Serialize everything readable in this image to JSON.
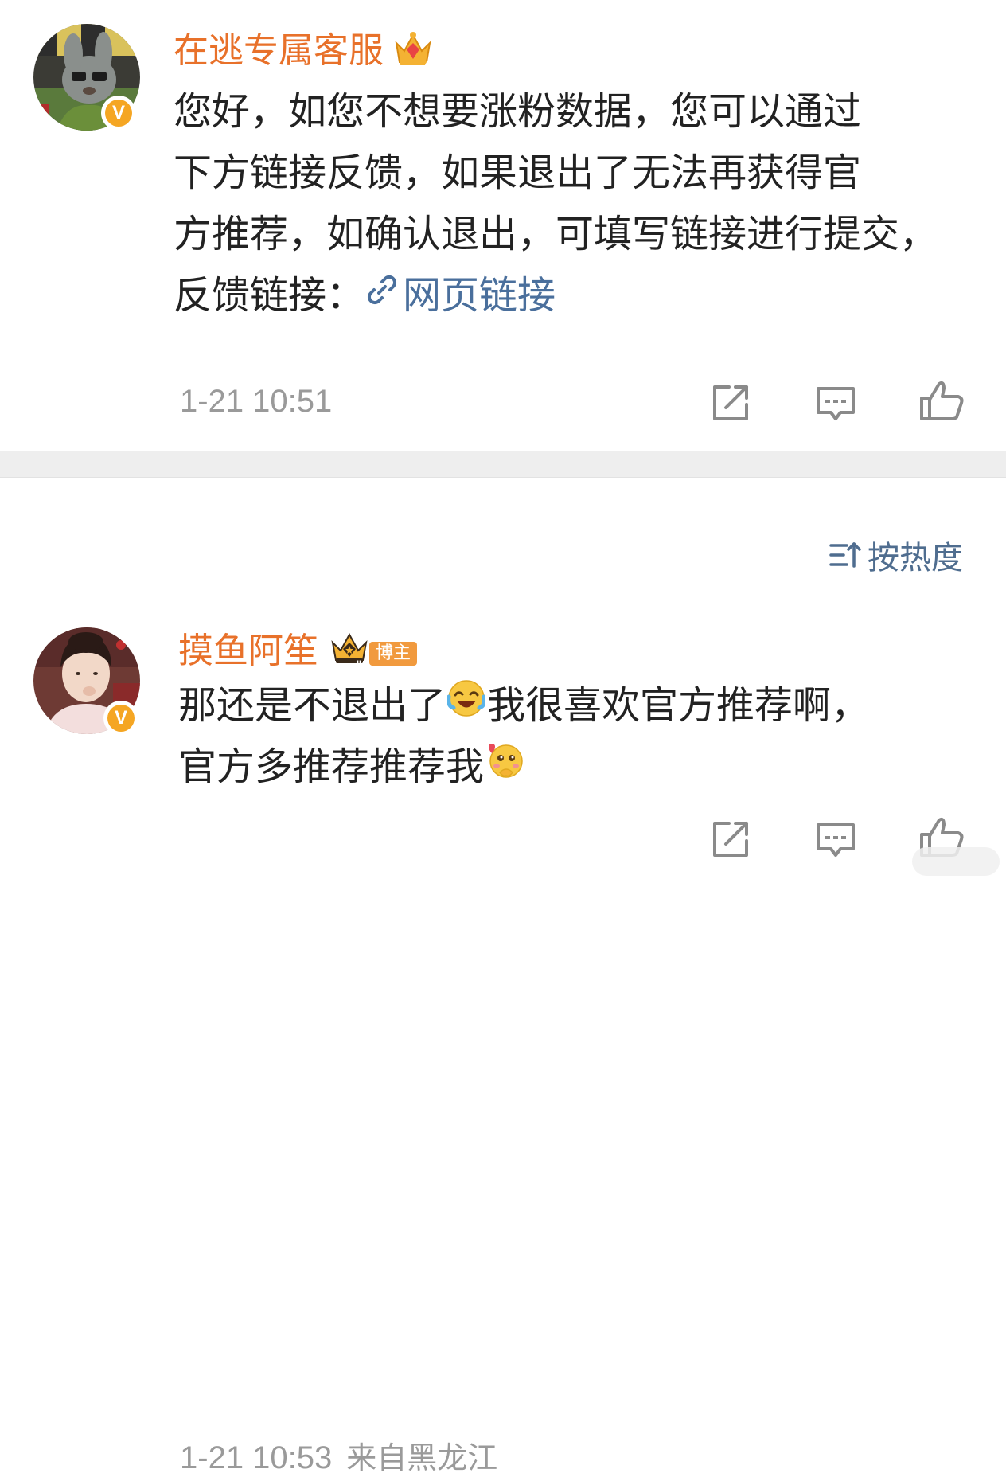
{
  "comments": [
    {
      "username": "在逃专属客服",
      "lines": [
        "您好，如您不想要涨粉数据，您可以通过",
        "下方链接反馈，如果退出了无法再获得官",
        "方推荐，如确认退出，可填写链接进行提交，",
        "反馈链接："
      ],
      "link_text": "网页链接",
      "timestamp": "1-21 10:51",
      "crown_level": "4",
      "verified_color": "#f5a623"
    },
    {
      "username": "摸鱼阿笙",
      "badge": "博主",
      "lines_before_emoji1": "那还是不退出了",
      "lines_after_emoji1": "我很喜欢官方推荐啊，",
      "line2": "官方多推荐推荐我",
      "timestamp": "1-21 10:53",
      "location": "来自黑龙江",
      "crown_level": "II",
      "verified_color": "#f5a623"
    }
  ],
  "sort": {
    "label": "按热度"
  },
  "icons": {
    "share": "share-icon",
    "comment": "comment-icon",
    "like": "like-icon",
    "sort": "sort-icon",
    "link": "link-icon"
  },
  "colors": {
    "username": "#e8712a",
    "link": "#4a6f9c",
    "meta": "#9a9a9a",
    "divider": "#eeeeee"
  }
}
